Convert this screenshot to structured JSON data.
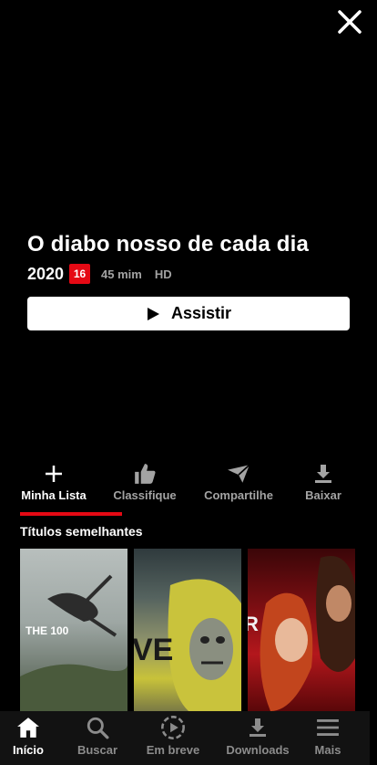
{
  "header": {
    "close_icon": "close-icon"
  },
  "title": {
    "name": "O diabo nosso de cada dia",
    "year": "2020",
    "rating": "16",
    "duration": "45 mim",
    "quality": "HD",
    "rating_color": "#e50914"
  },
  "play_button": {
    "label": "Assistir",
    "icon": "play-icon"
  },
  "actions": [
    {
      "label": "Minha Lista",
      "icon": "plus-icon",
      "active": true
    },
    {
      "label": "Classifique",
      "icon": "thumbs-up-icon",
      "active": false
    },
    {
      "label": "Compartilhe",
      "icon": "share-icon",
      "active": false
    },
    {
      "label": "Baixar",
      "icon": "download-icon",
      "active": false
    }
  ],
  "similar": {
    "title": "Títulos semelhantes",
    "posters": [
      {
        "caption": "THE 100"
      },
      {
        "caption": "VE"
      },
      {
        "caption": "R"
      }
    ]
  },
  "bottom_nav": [
    {
      "label": "Início",
      "icon": "home-icon",
      "active": true
    },
    {
      "label": "Buscar",
      "icon": "search-icon",
      "active": false
    },
    {
      "label": "Em breve",
      "icon": "coming-soon-icon",
      "active": false
    },
    {
      "label": "Downloads",
      "icon": "download-icon",
      "active": false
    },
    {
      "label": "Mais",
      "icon": "menu-icon",
      "active": false
    }
  ],
  "colors": {
    "accent": "#e50914",
    "background": "#000000",
    "nav_background": "#121212"
  }
}
